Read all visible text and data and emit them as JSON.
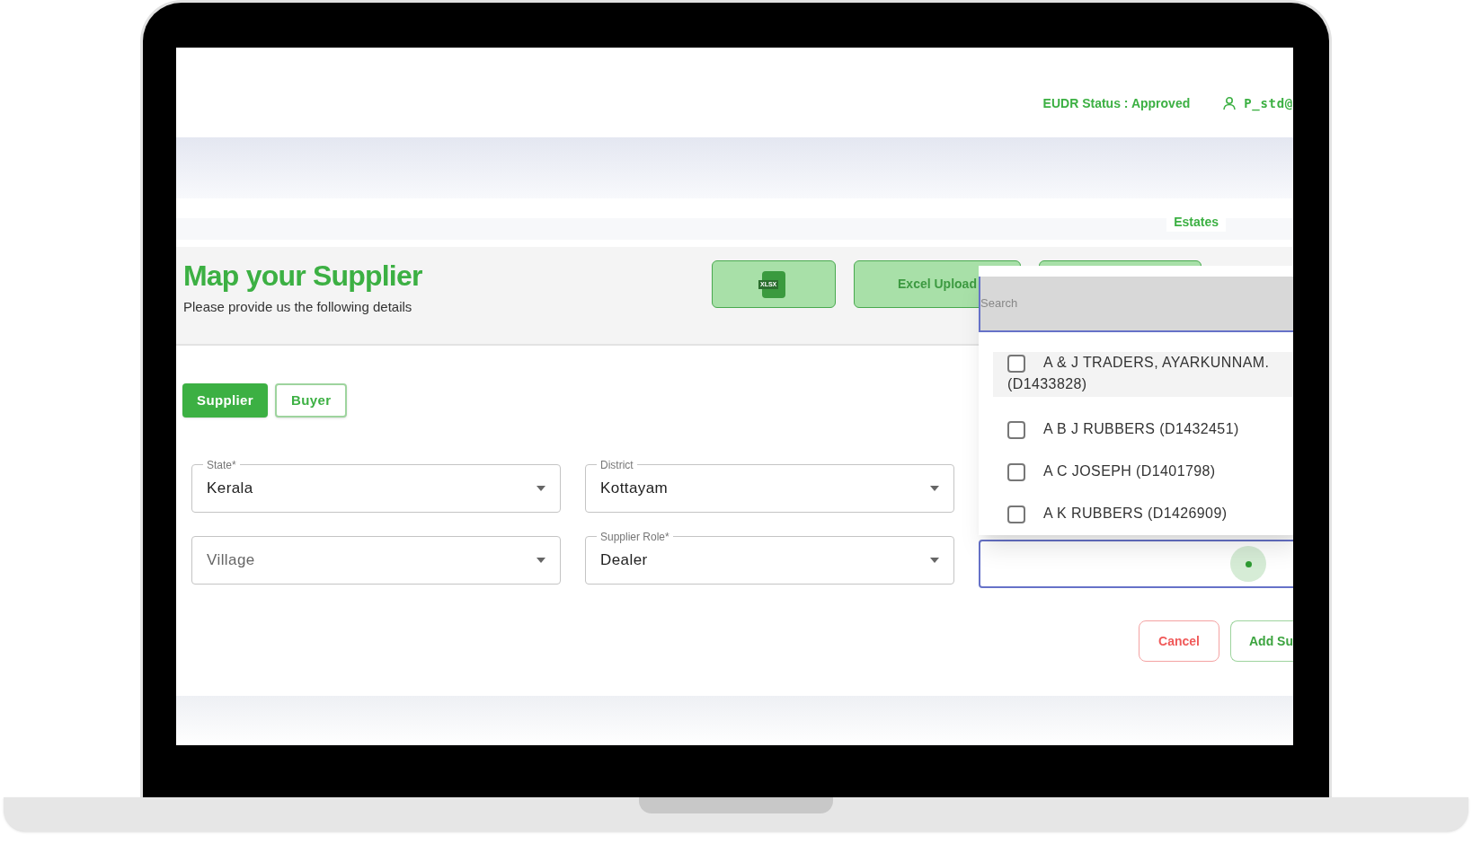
{
  "header": {
    "status": "EUDR Status : Approved",
    "user": "P_std@"
  },
  "nav": {
    "link": "Estates"
  },
  "page": {
    "title": "Map your Supplier",
    "subtitle": "Please provide us the following details"
  },
  "actions": [
    {
      "kind": "icon",
      "icon_text": "XLSX"
    },
    {
      "kind": "text",
      "label": "Excel Upload"
    },
    {
      "kind": "blank"
    }
  ],
  "tabs": [
    {
      "label": "Supplier",
      "selected": true
    },
    {
      "label": "Buyer",
      "selected": false
    }
  ],
  "field_rows": [
    {
      "fields": [
        {
          "label": "State*",
          "value": "Kerala"
        },
        {
          "label": "District",
          "value": "Kottayam"
        }
      ]
    },
    {
      "fields": [
        {
          "placeholder": "Village"
        },
        {
          "label": "Supplier Role*",
          "value": "Dealer"
        }
      ]
    }
  ],
  "supplier_dropdown": {
    "search_placeholder": "Search",
    "options": [
      {
        "label": "A & J TRADERS, AYARKUNNAM. (D1433828)",
        "checked": false,
        "highlighted": true
      },
      {
        "label": "A B J RUBBERS (D1432451)",
        "checked": false,
        "highlighted": false
      },
      {
        "label": "A C JOSEPH (D1401798)",
        "checked": false,
        "highlighted": false
      },
      {
        "label": "A K RUBBERS (D1426909)",
        "checked": false,
        "highlighted": false
      }
    ]
  },
  "buttons": [
    {
      "kind": "cancel",
      "label": "Cancel"
    },
    {
      "kind": "add",
      "label": "Add Su"
    }
  ]
}
